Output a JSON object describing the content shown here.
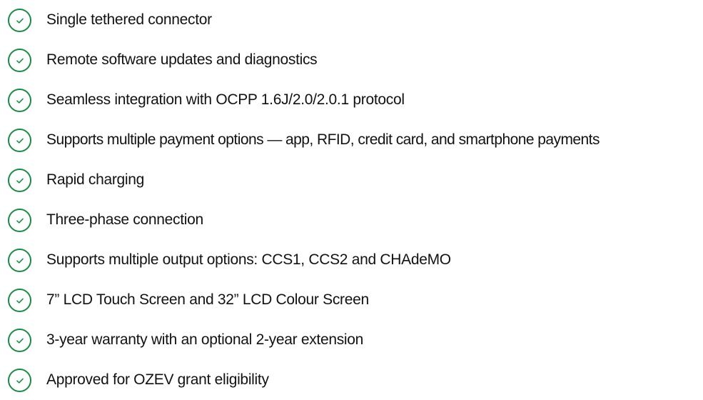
{
  "icon": "check-circle-icon",
  "accent_color": "#1b8a46",
  "features": [
    "Single tethered connector",
    "Remote software updates and diagnostics",
    "Seamless integration with OCPP 1.6J/2.0/2.0.1 protocol",
    "Supports multiple payment options — app, RFID, credit card, and smartphone payments",
    "Rapid charging",
    "Three-phase connection",
    "Supports multiple output options: CCS1, CCS2 and CHAdeMO",
    "7” LCD Touch Screen and 32” LCD Colour Screen",
    "3-year warranty with an optional 2-year extension",
    "Approved for OZEV grant eligibility"
  ]
}
